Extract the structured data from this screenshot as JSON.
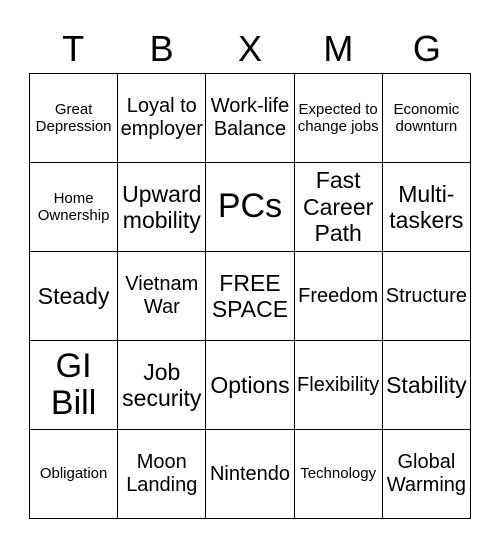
{
  "header": [
    "T",
    "B",
    "X",
    "M",
    "G"
  ],
  "rows": [
    [
      {
        "text": "Great Depression",
        "size": "s"
      },
      {
        "text": "Loyal to employer",
        "size": "m"
      },
      {
        "text": "Work-life Balance",
        "size": "m"
      },
      {
        "text": "Expected to change jobs",
        "size": "s"
      },
      {
        "text": "Economic downturn",
        "size": "s"
      }
    ],
    [
      {
        "text": "Home Ownership",
        "size": "s"
      },
      {
        "text": "Upward mobility",
        "size": "l"
      },
      {
        "text": "PCs",
        "size": "xl"
      },
      {
        "text": "Fast Career Path",
        "size": "l"
      },
      {
        "text": "Multi-taskers",
        "size": "l"
      }
    ],
    [
      {
        "text": "Steady",
        "size": "l"
      },
      {
        "text": "Vietnam War",
        "size": "m"
      },
      {
        "text": "FREE SPACE",
        "size": "l"
      },
      {
        "text": "Freedom",
        "size": "m"
      },
      {
        "text": "Structure",
        "size": "m"
      }
    ],
    [
      {
        "text": "GI Bill",
        "size": "xl"
      },
      {
        "text": "Job security",
        "size": "l"
      },
      {
        "text": "Options",
        "size": "l"
      },
      {
        "text": "Flexibility",
        "size": "m"
      },
      {
        "text": "Stability",
        "size": "l"
      }
    ],
    [
      {
        "text": "Obligation",
        "size": "s"
      },
      {
        "text": "Moon Landing",
        "size": "m"
      },
      {
        "text": "Nintendo",
        "size": "m"
      },
      {
        "text": "Technology",
        "size": "s"
      },
      {
        "text": "Global Warming",
        "size": "m"
      }
    ]
  ]
}
